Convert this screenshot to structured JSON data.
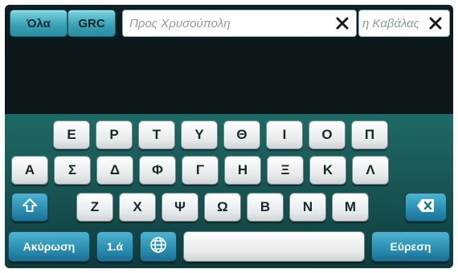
{
  "filters": {
    "all_label": "Όλα",
    "country_label": "GRC"
  },
  "search": {
    "field1_text": "Προς Χρυσούπολη",
    "field2_text": "η Καβάλας"
  },
  "keyboard": {
    "row1": [
      "Ε",
      "Ρ",
      "Τ",
      "Υ",
      "Θ",
      "Ι",
      "Ο",
      "Π"
    ],
    "row2": [
      "Α",
      "Σ",
      "Δ",
      "Φ",
      "Γ",
      "Η",
      "Ξ",
      "Κ",
      "Λ"
    ],
    "row3": [
      "Ζ",
      "Χ",
      "Ψ",
      "Ω",
      "Β",
      "Ν",
      "Μ"
    ],
    "cancel_label": "Ακύρωση",
    "mode_label": "1.ά",
    "search_label": "Εύρεση"
  },
  "icons": {
    "clear": "close-icon",
    "shift": "shift-icon",
    "backspace": "backspace-icon",
    "language": "globe-icon"
  },
  "colors": {
    "accent_blue": "#2a8db0",
    "keyboard_bg": "#164f4e",
    "filter_button": "#3aa3b6"
  }
}
